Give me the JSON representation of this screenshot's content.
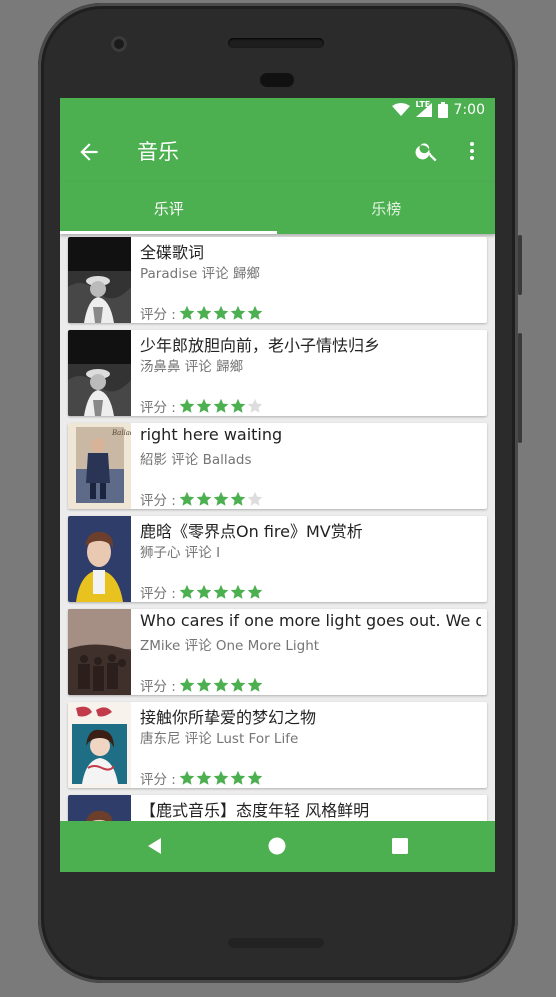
{
  "status_bar": {
    "time": "7:00",
    "network": "LTE",
    "icons": [
      "wifi-icon",
      "cell-signal-icon",
      "battery-icon"
    ]
  },
  "app_bar": {
    "title": "音乐",
    "icons": [
      "back-arrow-icon",
      "search-icon",
      "more-vert-icon"
    ]
  },
  "tabs": [
    {
      "label": "乐评",
      "selected": true
    },
    {
      "label": "乐榜",
      "selected": false
    }
  ],
  "rating_label": "评分 :",
  "colors": {
    "primary": "#4caf50",
    "star_filled": "#4caf50",
    "star_empty": "#dddddd"
  },
  "reviews": [
    {
      "title": "全碟歌词",
      "subtitle": "Paradise 评论 歸鄉",
      "rating": 5,
      "max_rating": 5,
      "cover": "dark-bw-portrait"
    },
    {
      "title": "少年郎放胆向前，老小子情怯归乡",
      "subtitle": "汤鼻鼻 评论 歸鄉",
      "rating": 4,
      "max_rating": 5,
      "cover": "dark-bw-portrait"
    },
    {
      "title": "right here waiting",
      "subtitle": "紹影 评论 Ballads",
      "rating": 4,
      "max_rating": 5,
      "cover": "ballads-album"
    },
    {
      "title": "鹿晗《零界点On fire》MV赏析",
      "subtitle": "狮子心 评论 I",
      "rating": 5,
      "max_rating": 5,
      "cover": "yellow-jacket-portrait"
    },
    {
      "title": "Who cares if one more light goes out. We do.",
      "subtitle": "ZMike 评论 One More Light",
      "rating": 5,
      "max_rating": 5,
      "cover": "one-more-light-album"
    },
    {
      "title": "接触你所挚爱的梦幻之物",
      "subtitle": "唐东尼 评论 Lust For Life",
      "rating": 5,
      "max_rating": 5,
      "cover": "lust-for-life-album"
    },
    {
      "title": "【鹿式音乐】态度年轻 风格鲜明",
      "subtitle": "",
      "rating": null,
      "max_rating": 5,
      "cover": "yellow-jacket-portrait"
    }
  ],
  "nav_bar": {
    "icons": [
      "back-triangle-icon",
      "home-circle-icon",
      "recents-square-icon"
    ]
  }
}
